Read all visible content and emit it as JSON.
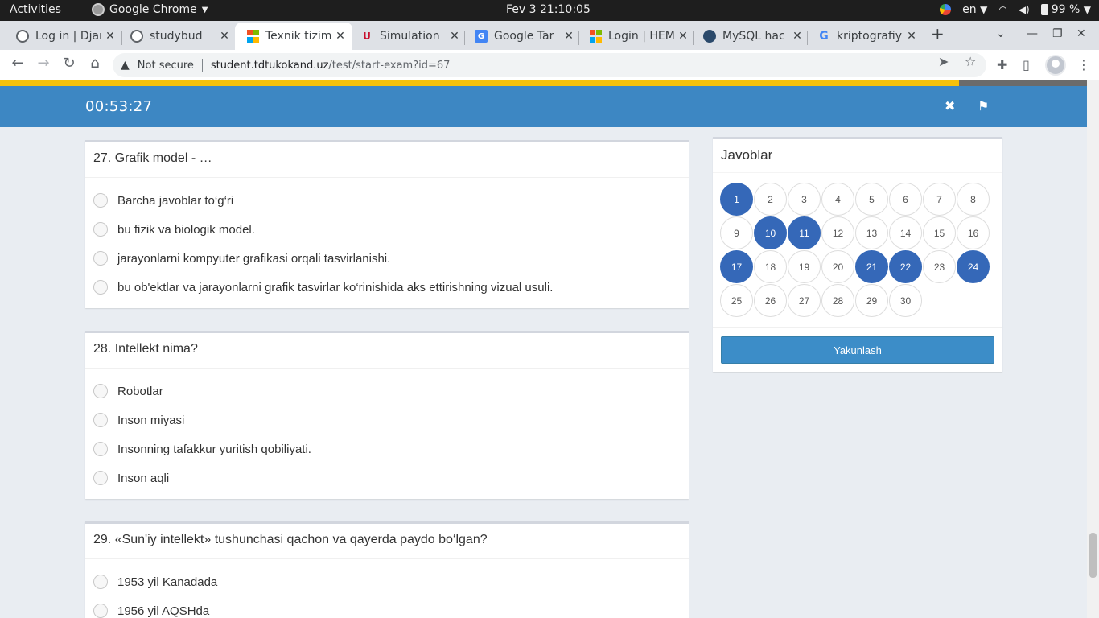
{
  "system_bar": {
    "activities": "Activities",
    "app_name": "Google Chrome",
    "datetime": "Fev 3  21:10:05",
    "language": "en",
    "battery": "99 %"
  },
  "tabs": [
    {
      "title": "Log in | Djan",
      "favicon": "globe-icon"
    },
    {
      "title": "studybud",
      "favicon": "globe-icon"
    },
    {
      "title": "Texnik tizim",
      "favicon": "microsoft-icon",
      "active": true
    },
    {
      "title": "Simulation",
      "favicon": "uh-logo-icon"
    },
    {
      "title": "Google Tar",
      "favicon": "translate-icon"
    },
    {
      "title": "Login | HEM",
      "favicon": "microsoft-icon"
    },
    {
      "title": "MySQL hac",
      "favicon": "mysql-icon"
    },
    {
      "title": "kriptografiy",
      "favicon": "google-icon"
    }
  ],
  "omnibox": {
    "security": "Not secure",
    "host": "student.tdtukokand.uz",
    "path": "/test/start-exam?id=67"
  },
  "exam": {
    "progress_fraction": 0.882,
    "timer": "00:53:27",
    "questions": [
      {
        "title": "27. Grafik model - …",
        "options": [
          "Barcha javoblar to‘g‘ri",
          "bu fizik va biologik model.",
          "jarayonlarni kompyuter grafikasi orqali tasvirlanishi.",
          "bu ob'ektlar va jarayonlarni grafik tasvirlar ko‘rinishida aks ettirishning vizual usuli."
        ]
      },
      {
        "title": "28. Intellekt nima?",
        "options": [
          "Robotlar",
          "Inson miyasi",
          "Insonning tafakkur yuritish qobiliyati.",
          "Inson aqli"
        ]
      },
      {
        "title": "29. «Sun'iy intellekt» tushunchasi qachon va qayerda paydo bo‘lgan?",
        "options": [
          "1953 yil Kanadada",
          "1956 yil AQSHda"
        ]
      }
    ],
    "answers_panel": {
      "title": "Javoblar",
      "numbers": [
        "1",
        "2",
        "3",
        "4",
        "5",
        "6",
        "7",
        "8",
        "9",
        "10",
        "11",
        "12",
        "13",
        "14",
        "15",
        "16",
        "17",
        "18",
        "19",
        "20",
        "21",
        "22",
        "23",
        "24",
        "25",
        "26",
        "27",
        "28",
        "29",
        "30"
      ],
      "answered": [
        "1",
        "10",
        "11",
        "17",
        "21",
        "22",
        "24"
      ],
      "finish_label": "Yakunlash"
    }
  },
  "colors": {
    "header": "#3d87c3",
    "answered": "#3568b8",
    "progress": "#f5c10b"
  }
}
